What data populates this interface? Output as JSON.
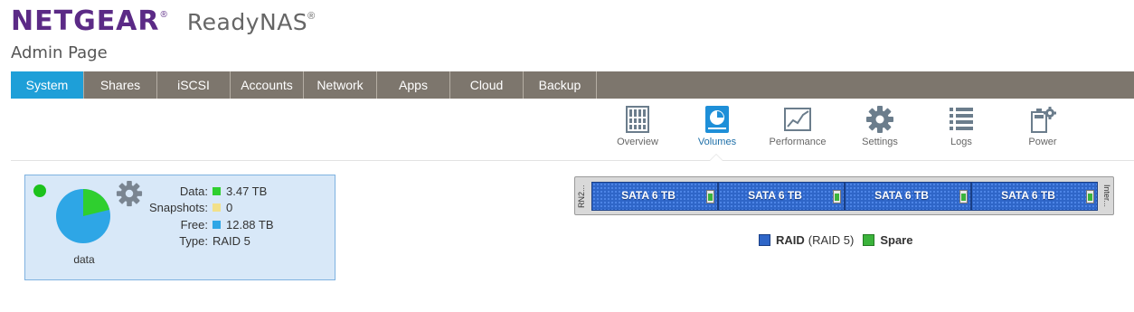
{
  "brand": {
    "logo": "NETGEAR",
    "logo_mark": "®",
    "product": "ReadyNAS",
    "product_mark": "®"
  },
  "page": {
    "title": "Admin Page"
  },
  "tabs": [
    {
      "label": "System",
      "active": true
    },
    {
      "label": "Shares"
    },
    {
      "label": "iSCSI"
    },
    {
      "label": "Accounts"
    },
    {
      "label": "Network"
    },
    {
      "label": "Apps"
    },
    {
      "label": "Cloud"
    },
    {
      "label": "Backup"
    }
  ],
  "subnav": [
    {
      "label": "Overview",
      "icon": "overview-icon"
    },
    {
      "label": "Volumes",
      "icon": "volumes-icon",
      "active": true
    },
    {
      "label": "Performance",
      "icon": "performance-icon"
    },
    {
      "label": "Settings",
      "icon": "gear-icon"
    },
    {
      "label": "Logs",
      "icon": "list-icon"
    },
    {
      "label": "Power",
      "icon": "power-icon"
    }
  ],
  "volume": {
    "name": "data",
    "status_color": "#1cc21c",
    "stats": [
      {
        "key": "Data:",
        "value": "3.47 TB",
        "color": "#2fcf2f"
      },
      {
        "key": "Snapshots:",
        "value": "0",
        "color": "#f2e08a"
      },
      {
        "key": "Free:",
        "value": "12.88 TB",
        "color": "#2ea6e6"
      },
      {
        "key": "Type:",
        "value": "RAID 5"
      }
    ],
    "usage_fraction": 0.212
  },
  "enclosure": {
    "left_label": "RN2...",
    "right_label": "Inter...",
    "drives": [
      "SATA 6 TB",
      "SATA 6 TB",
      "SATA 6 TB",
      "SATA 6 TB"
    ]
  },
  "legend": {
    "raid_label": "RAID",
    "raid_detail": "(RAID 5)",
    "raid_color": "#2f66c8",
    "spare_label": "Spare",
    "spare_color": "#3bb33b"
  },
  "colors": {
    "accent": "#1e9fd8",
    "tabbar": "#7d766d",
    "brand": "#5b2a86"
  }
}
